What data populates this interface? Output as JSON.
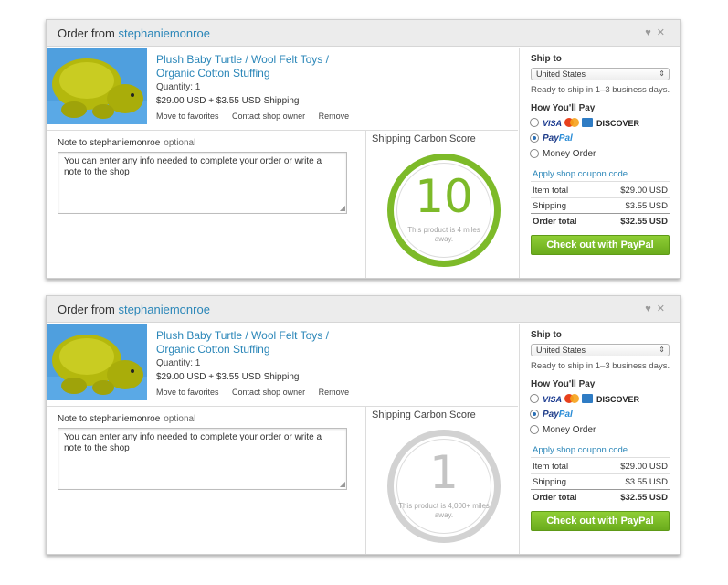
{
  "orders": [
    {
      "header": {
        "prefix": "Order from",
        "shop": "stephaniemonroe",
        "icons": [
          "heart-icon",
          "close-icon"
        ]
      },
      "item": {
        "title": "Plush Baby Turtle / Wool Felt Toys / Organic Cotton Stuffing",
        "quantity": "Quantity: 1",
        "price": "$29.00 USD + $3.55 USD Shipping",
        "actions": [
          "Move to favorites",
          "Contact shop owner",
          "Remove"
        ]
      },
      "note": {
        "label": "Note to stephaniemonroe",
        "optional": "optional",
        "placeholder": "You can enter any info needed to complete your order or write a note to the shop"
      },
      "carbon": {
        "title": "Shipping Carbon Score",
        "score": "10",
        "distance": "This product is 4 miles away.",
        "color": "#7dba29"
      },
      "payment": {
        "ship_label": "Ship to",
        "ship_country": "United States",
        "ready": "Ready to ship in 1–3 business days.",
        "pay_label": "How You'll Pay",
        "visa": "VISA",
        "discover": "DISCOVER",
        "paypal_a": "Pay",
        "paypal_b": "Pal",
        "money_order": "Money Order",
        "selected": "PayPal",
        "coupon": "Apply shop coupon code",
        "item_total_label": "Item total",
        "item_total": "$29.00 USD",
        "shipping_label": "Shipping",
        "shipping": "$3.55 USD",
        "order_total_label": "Order total",
        "order_total": "$32.55 USD",
        "checkout": "Check out with PayPal"
      }
    },
    {
      "header": {
        "prefix": "Order from",
        "shop": "stephaniemonroe",
        "icons": [
          "heart-icon",
          "close-icon"
        ]
      },
      "item": {
        "title": "Plush Baby Turtle / Wool Felt Toys / Organic Cotton Stuffing",
        "quantity": "Quantity: 1",
        "price": "$29.00 USD + $3.55 USD Shipping",
        "actions": [
          "Move to favorites",
          "Contact shop owner",
          "Remove"
        ]
      },
      "note": {
        "label": "Note to stephaniemonroe",
        "optional": "optional",
        "placeholder": "You can enter any info needed to complete your order or write a note to the shop"
      },
      "carbon": {
        "title": "Shipping Carbon Score",
        "score": "1",
        "distance": "This product is 4,000+ miles away.",
        "color": "#c4c4c4"
      },
      "payment": {
        "ship_label": "Ship to",
        "ship_country": "United States",
        "ready": "Ready to ship in 1–3 business days.",
        "pay_label": "How You'll Pay",
        "visa": "VISA",
        "discover": "DISCOVER",
        "paypal_a": "Pay",
        "paypal_b": "Pal",
        "money_order": "Money Order",
        "selected": "PayPal",
        "coupon": "Apply shop coupon code",
        "item_total_label": "Item total",
        "item_total": "$29.00 USD",
        "shipping_label": "Shipping",
        "shipping": "$3.55 USD",
        "order_total_label": "Order total",
        "order_total": "$32.55 USD",
        "checkout": "Check out with PayPal"
      }
    }
  ]
}
